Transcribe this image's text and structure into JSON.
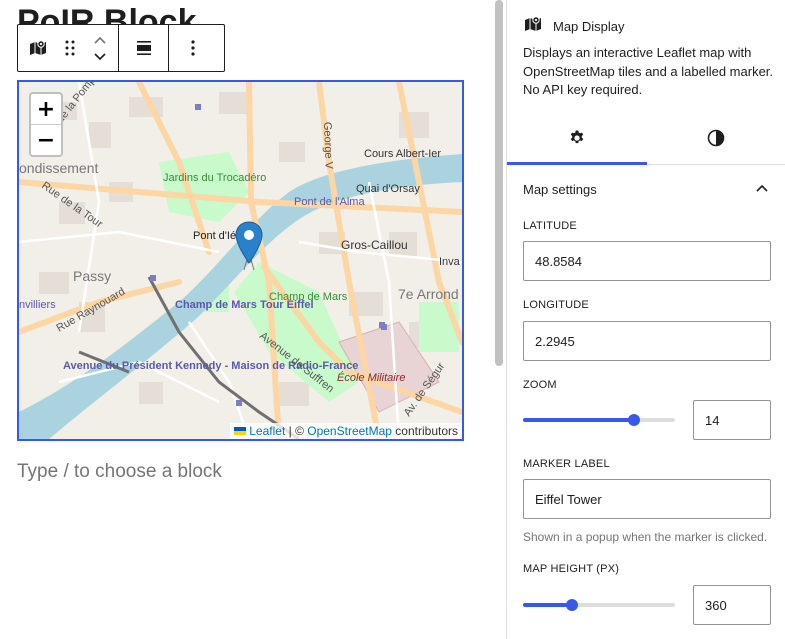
{
  "editor": {
    "post_title": "PoIR Block",
    "appender_placeholder": "Type / to choose a block"
  },
  "toolbar": {
    "block_icon": "map-icon",
    "drag_icon": "drag-handle-icon",
    "move_up_icon": "chevron-up-icon",
    "move_down_icon": "chevron-down-icon",
    "align_icon": "align-icon",
    "more_icon": "more-vertical-icon"
  },
  "map": {
    "zoom_in": "+",
    "zoom_out": "−",
    "attribution": {
      "leaflet": "Leaflet",
      "separator": " | © ",
      "osm": "OpenStreetMap",
      "suffix": " contributors"
    },
    "labels": {
      "l1": "Rue de la Pompe",
      "l2": "ondissement",
      "l3": "Rue de la Tour",
      "l4": "Jardins du Trocadéro",
      "l5": "Pont d'Iéna",
      "l6": "Passy",
      "l7": "nvilliers",
      "l8": "Rue Raynouard",
      "l9": "Champ de Mars Tour Eiffel",
      "l10": "Champ de Mars",
      "l11": "Avenue du Président Kennedy - Maison de Radio-France",
      "l12": "Avenue de Suffren",
      "l13": "École Militaire",
      "l14": "Gros-Caillou",
      "l15": "7e Arrond",
      "l16": "Pont de l'Alma",
      "l17": "Quai d'Orsay",
      "l18": "Cours Albert-Ier",
      "l19": "George V",
      "l20": "Inva",
      "l21": "Av. de Ségur"
    },
    "marker_icon": "map-marker-icon"
  },
  "sidebar": {
    "block": {
      "icon": "map-icon",
      "title": "Map Display",
      "description": "Displays an interactive Leaflet map with OpenStreetMap tiles and a labelled marker. No API key required."
    },
    "tabs": {
      "settings_icon": "gear-icon",
      "styles_icon": "half-circle-icon"
    },
    "panel": {
      "title": "Map settings",
      "toggle_icon": "chevron-up-icon"
    },
    "fields": {
      "latitude_label": "LATITUDE",
      "latitude_value": "48.8584",
      "longitude_label": "LONGITUDE",
      "longitude_value": "2.2945",
      "zoom_label": "ZOOM",
      "zoom_value": "14",
      "zoom_fraction": 0.73,
      "marker_label_label": "MARKER LABEL",
      "marker_label_value": "Eiffel Tower",
      "marker_help": "Shown in a popup when the marker is clicked.",
      "height_label": "MAP HEIGHT (PX)",
      "height_value": "360",
      "height_fraction": 0.32
    }
  },
  "colors": {
    "accent": "#3858e9",
    "map_land": "#f2efe9",
    "map_water": "#aad3df",
    "map_park": "#c8facc",
    "map_major_road": "#fcd6a4"
  }
}
